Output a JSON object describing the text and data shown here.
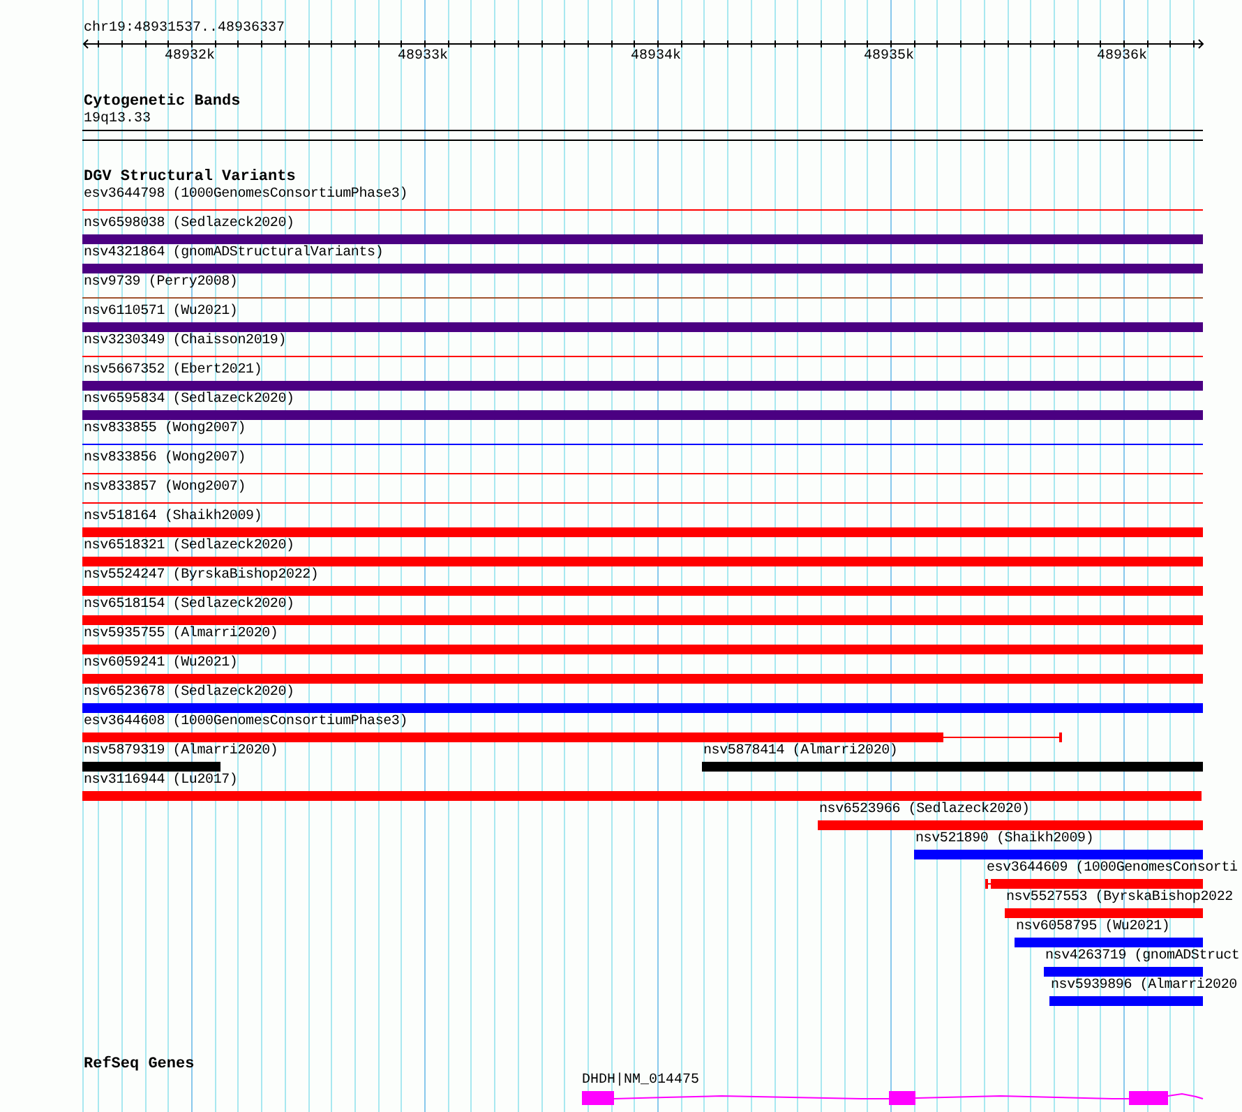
{
  "ruler": {
    "location": "chr19:48931537..48936337",
    "ticks": [
      "48932k",
      "48933k",
      "48934k",
      "48935k",
      "48936k"
    ]
  },
  "cytogenetic_bands": {
    "title": "Cytogenetic Bands",
    "band": "19q13.33"
  },
  "dgv_structural_variants": {
    "title": "DGV Structural Variants",
    "rows": [
      [
        {
          "label": "esv3644798 (1000GenomesConsortiumPhase3)",
          "kind": "line",
          "color": "#ff0000"
        }
      ],
      [
        {
          "label": "nsv6598038 (Sedlazeck2020)",
          "kind": "bar",
          "color": "#4b0082"
        }
      ],
      [
        {
          "label": "nsv4321864 (gnomADStructuralVariants)",
          "kind": "bar",
          "color": "#4b0082"
        }
      ],
      [
        {
          "label": "nsv9739 (Perry2008)",
          "kind": "line",
          "color": "#a0522d"
        }
      ],
      [
        {
          "label": "nsv6110571 (Wu2021)",
          "kind": "bar",
          "color": "#4b0082"
        }
      ],
      [
        {
          "label": "nsv3230349 (Chaisson2019)",
          "kind": "line",
          "color": "#ff0000"
        }
      ],
      [
        {
          "label": "nsv5667352 (Ebert2021)",
          "kind": "bar",
          "color": "#4b0082"
        }
      ],
      [
        {
          "label": "nsv6595834 (Sedlazeck2020)",
          "kind": "bar",
          "color": "#4b0082"
        }
      ],
      [
        {
          "label": "nsv833855 (Wong2007)",
          "kind": "line",
          "color": "#0000ff"
        }
      ],
      [
        {
          "label": "nsv833856 (Wong2007)",
          "kind": "line",
          "color": "#ff0000"
        }
      ],
      [
        {
          "label": "nsv833857 (Wong2007)",
          "kind": "line",
          "color": "#ff0000"
        }
      ],
      [
        {
          "label": "nsv518164 (Shaikh2009)",
          "kind": "bar",
          "color": "#ff0000"
        }
      ],
      [
        {
          "label": "nsv6518321 (Sedlazeck2020)",
          "kind": "bar",
          "color": "#ff0000"
        }
      ],
      [
        {
          "label": "nsv5524247 (ByrskaBishop2022)",
          "kind": "bar",
          "color": "#ff0000"
        }
      ],
      [
        {
          "label": "nsv6518154 (Sedlazeck2020)",
          "kind": "bar",
          "color": "#ff0000"
        }
      ],
      [
        {
          "label": "nsv5935755 (Almarri2020)",
          "kind": "bar",
          "color": "#ff0000"
        }
      ],
      [
        {
          "label": "nsv6059241 (Wu2021)",
          "kind": "bar",
          "color": "#ff0000"
        }
      ],
      [
        {
          "label": "nsv6523678 (Sedlazeck2020)",
          "kind": "bar",
          "color": "#0000ff"
        }
      ],
      [
        {
          "label": "esv3644608 (1000GenomesConsortiumPhase3)",
          "kind": "bar",
          "color": "#ff0000"
        }
      ],
      [
        {
          "label": "nsv5879319 (Almarri2020)",
          "kind": "bar",
          "color": "#000000"
        },
        {
          "label": "nsv5878414 (Almarri2020)",
          "kind": "bar",
          "color": "#000000"
        }
      ],
      [
        {
          "label": "nsv3116944 (Lu2017)",
          "kind": "bar",
          "color": "#ff0000"
        }
      ],
      [
        {
          "label": "nsv6523966 (Sedlazeck2020)",
          "kind": "bar",
          "color": "#ff0000"
        }
      ],
      [
        {
          "label": "nsv521890 (Shaikh2009)",
          "kind": "bar",
          "color": "#0000ff"
        }
      ],
      [
        {
          "label": "esv3644609 (1000GenomesConsorti",
          "kind": "bar",
          "color": "#ff0000"
        }
      ],
      [
        {
          "label": "nsv5527553 (ByrskaBishop2022",
          "kind": "bar",
          "color": "#ff0000"
        }
      ],
      [
        {
          "label": "nsv6058795 (Wu2021)",
          "kind": "bar",
          "color": "#0000ff"
        }
      ],
      [
        {
          "label": "nsv4263719 (gnomADStruct",
          "kind": "bar",
          "color": "#0000ff"
        }
      ],
      [
        {
          "label": "nsv5939896 (Almarri2020",
          "kind": "bar",
          "color": "#0000ff"
        }
      ]
    ]
  },
  "refseq_genes": {
    "title": "RefSeq Genes",
    "genes": [
      {
        "label": "DHDH|NM_014475"
      }
    ]
  }
}
